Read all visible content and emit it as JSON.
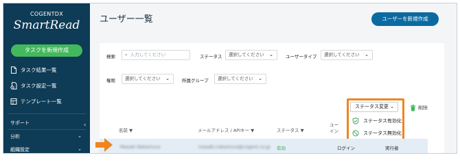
{
  "sidebar": {
    "brand_top": "COGENTDX",
    "brand_main": "SmartRead",
    "create_task_label": "タスクを新規作成",
    "nav": [
      {
        "label": "タスク結果一覧",
        "icon": "document-icon"
      },
      {
        "label": "タスク設定一覧",
        "icon": "gear-document-icon"
      },
      {
        "label": "テンプレート一覧",
        "icon": "template-icon"
      }
    ],
    "sections": [
      {
        "label": "サポート"
      },
      {
        "label": "分析"
      },
      {
        "label": "組織設定"
      }
    ]
  },
  "header": {
    "title": "ユーザー一覧",
    "add_user_label": "ユーザーを新規作成"
  },
  "filters": {
    "search_label": "検索",
    "search_placeholder": "入力してください",
    "status_label": "ステータス",
    "status_value": "選択してください",
    "usertype_label": "ユーザータイプ",
    "usertype_value": "選択してください",
    "role_label": "権限",
    "role_value": "選択してください",
    "group_label": "所属グループ",
    "group_value": "選択してください"
  },
  "actions": {
    "status_change_label": "ステータス変更",
    "delete_label": "削除",
    "menu": [
      {
        "label": "ステータス有効化",
        "icon": "shield-check-icon",
        "color": "#3aa657"
      },
      {
        "label": "ステータス無効化",
        "icon": "ban-icon",
        "color": "#3aa657"
      }
    ]
  },
  "table": {
    "columns": [
      "名前 ▼",
      "メールアドレス / APIキー ▼",
      "ステータス ▼",
      "ユー",
      "イン"
    ],
    "rows": [
      {
        "name": "Masaki Nakamura",
        "email": "masaki.nakamura@cogent.co.jp",
        "status": "有効",
        "login": "ログイン",
        "role": "実行者"
      }
    ]
  },
  "colors": {
    "sidebar_bg": "#0e3b55",
    "accent_green": "#43b85c",
    "primary_blue": "#0a6aa1",
    "highlight_orange": "#f0841f"
  }
}
